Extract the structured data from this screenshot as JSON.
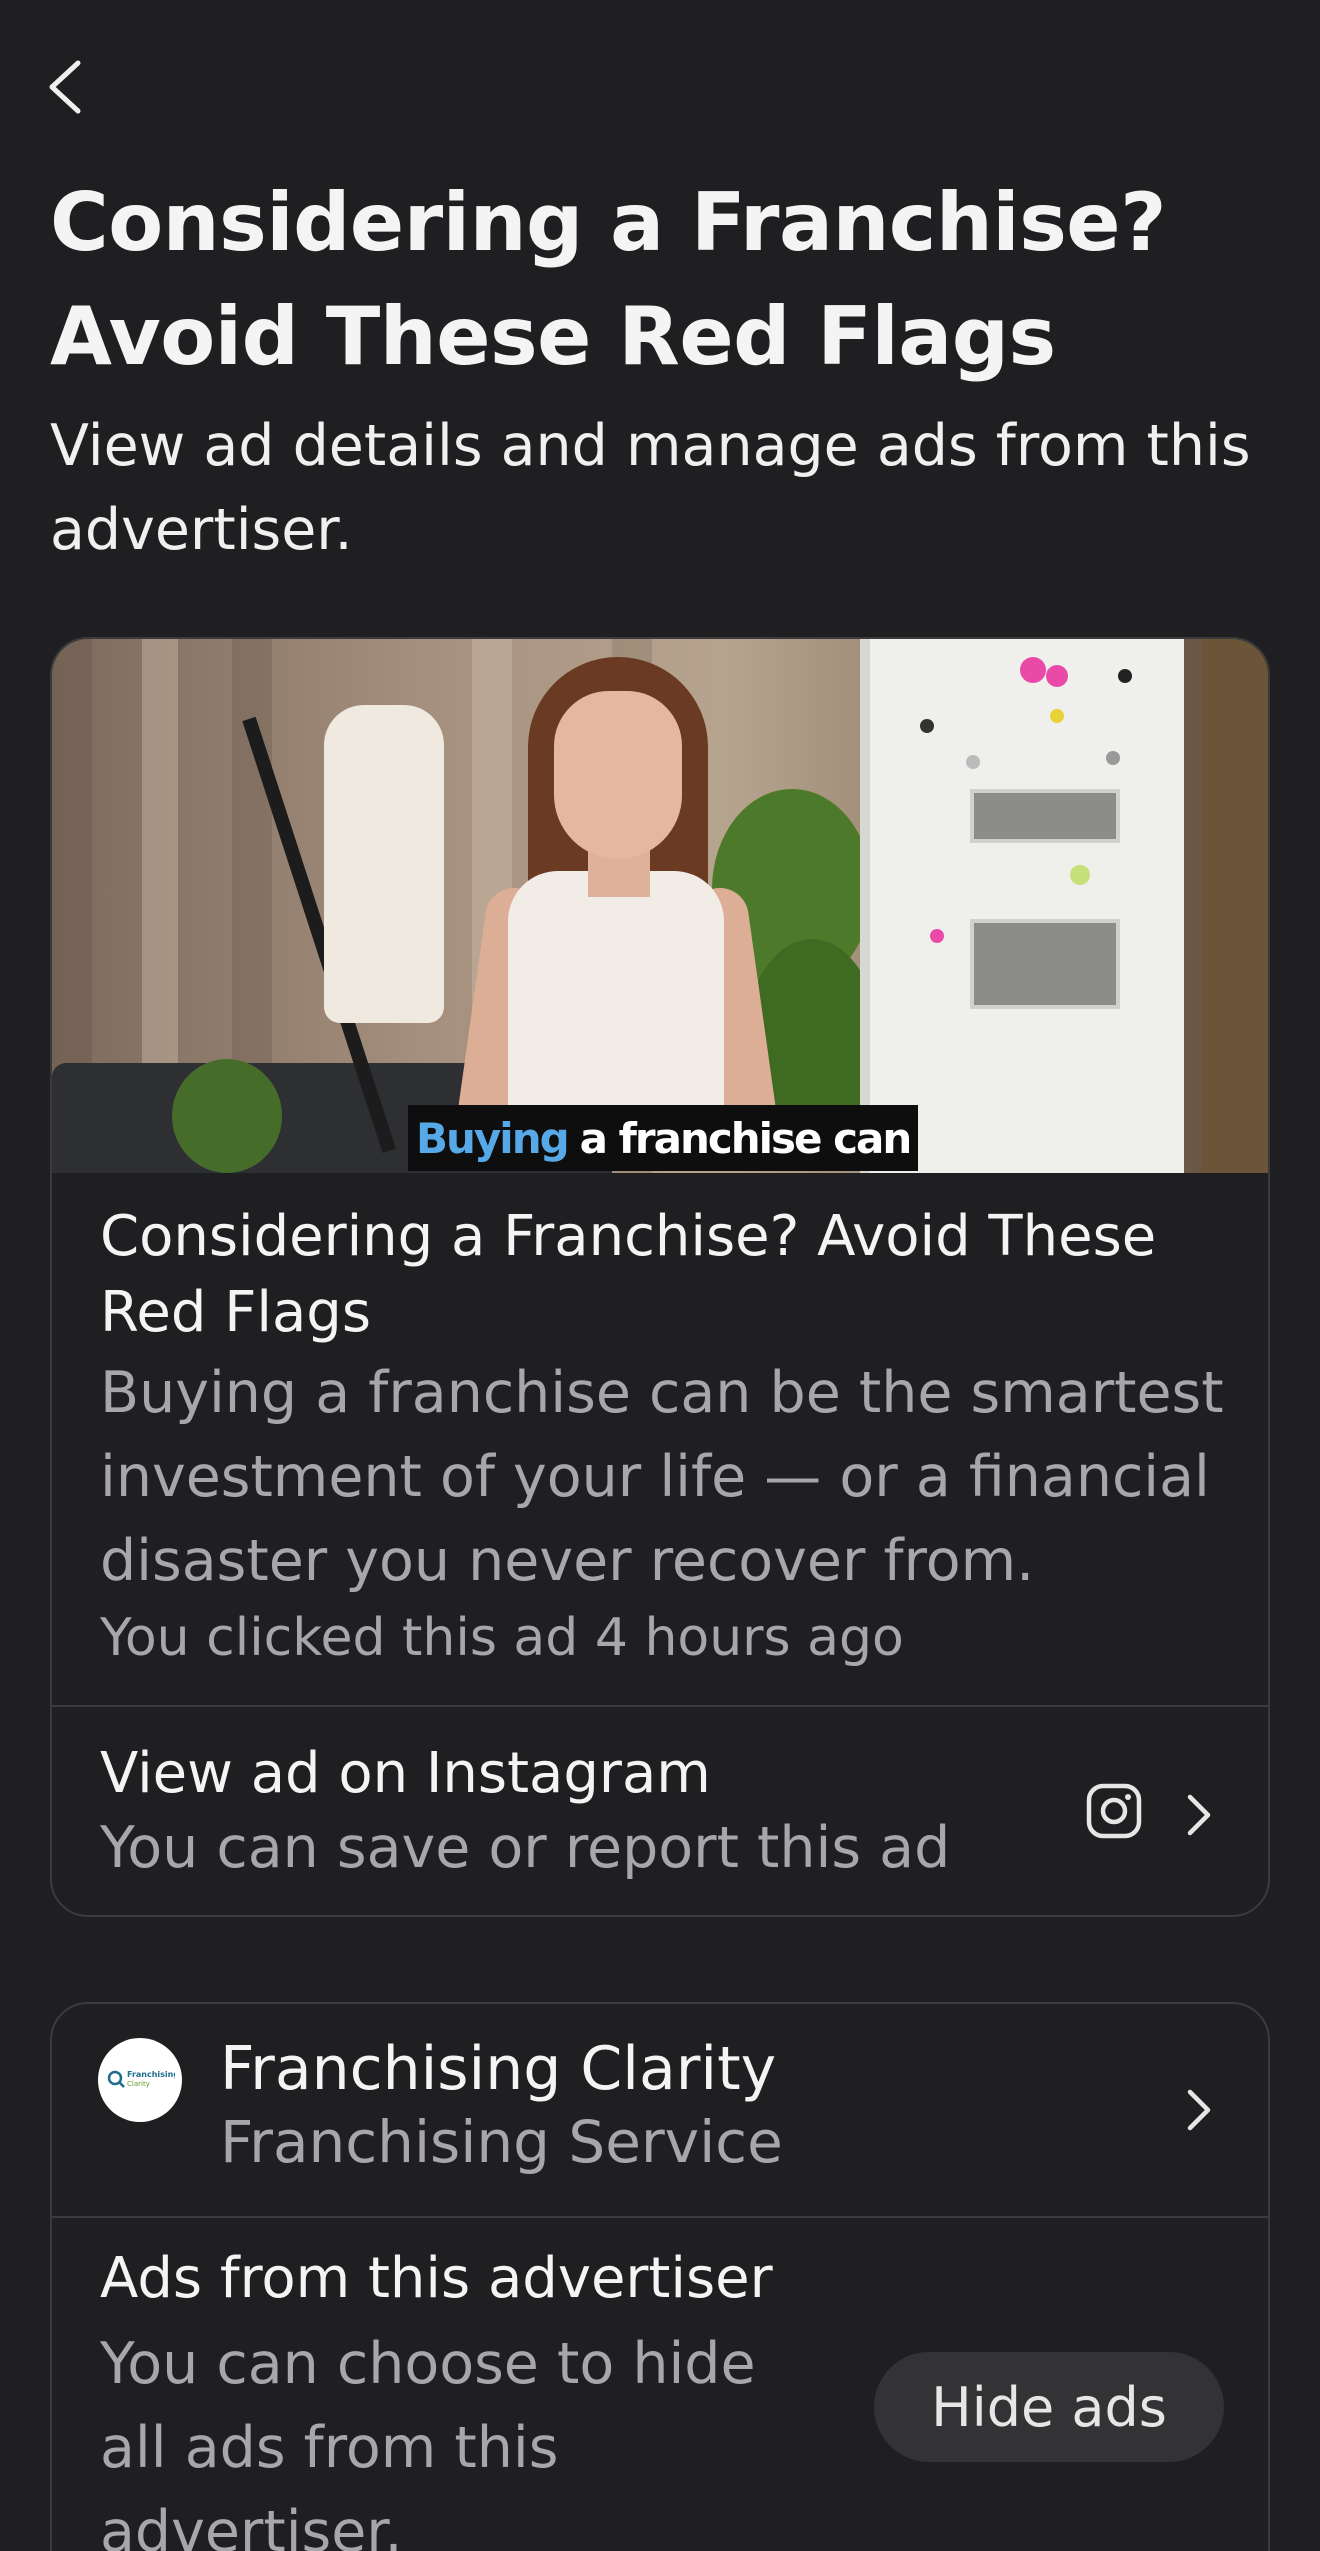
{
  "header": {
    "back_label": "Back",
    "title": "Considering a Franchise? Avoid These Red Flags",
    "subtitle": "View ad details and manage ads from this advertiser."
  },
  "ad": {
    "image_caption_highlight": "Buying",
    "image_caption_rest": "a franchise can",
    "headline": "Considering a Franchise? Avoid These Red Flags",
    "description": "Buying a franchise can be the smartest investment of your life — or a financial disaster you never recover from.",
    "clicked_info": "You clicked this ad 4 hours ago",
    "view_on_instagram": {
      "title": "View ad on Instagram",
      "subtitle": "You can save or report this ad",
      "icon": "instagram-icon"
    }
  },
  "advertiser": {
    "name": "Franchising Clarity",
    "category": "Franchising Service",
    "logo_text_1": "Franchising",
    "logo_text_2": "Clarity",
    "ads_section_title": "Ads from this advertiser",
    "ads_section_desc": "You can choose to hide all ads from this advertiser.",
    "hide_button_label": "Hide ads"
  },
  "colors": {
    "background": "#1f1f21",
    "card_border": "#3b3b3e",
    "secondary_text": "#a7a7a9",
    "caption_highlight": "#56a8e6"
  }
}
